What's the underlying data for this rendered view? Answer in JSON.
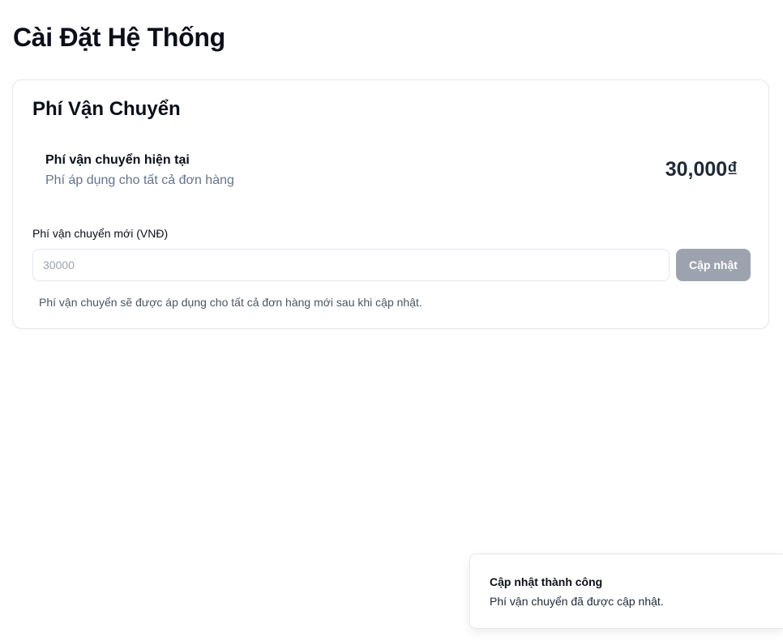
{
  "page": {
    "title": "Cài Đặt Hệ Thống"
  },
  "shipping_card": {
    "title": "Phí Vận Chuyển",
    "current": {
      "label": "Phí vận chuyển hiện tại",
      "description": "Phí áp dụng cho tất cả đơn hàng",
      "amount": "30,000₫"
    },
    "new_fee": {
      "label": "Phí vận chuyển mới (VNĐ)",
      "placeholder": "30000",
      "value": ""
    },
    "update_button_label": "Cập nhật",
    "helper_text": "Phí vận chuyển sẽ được áp dụng cho tất cả đơn hàng mới sau khi cập nhật."
  },
  "toast": {
    "title": "Cập nhật thành công",
    "description": "Phí vận chuyển đã được cập nhật."
  },
  "colors": {
    "button_disabled": "#9ca3af",
    "muted_text": "#64748b",
    "border": "#e5e7eb"
  }
}
